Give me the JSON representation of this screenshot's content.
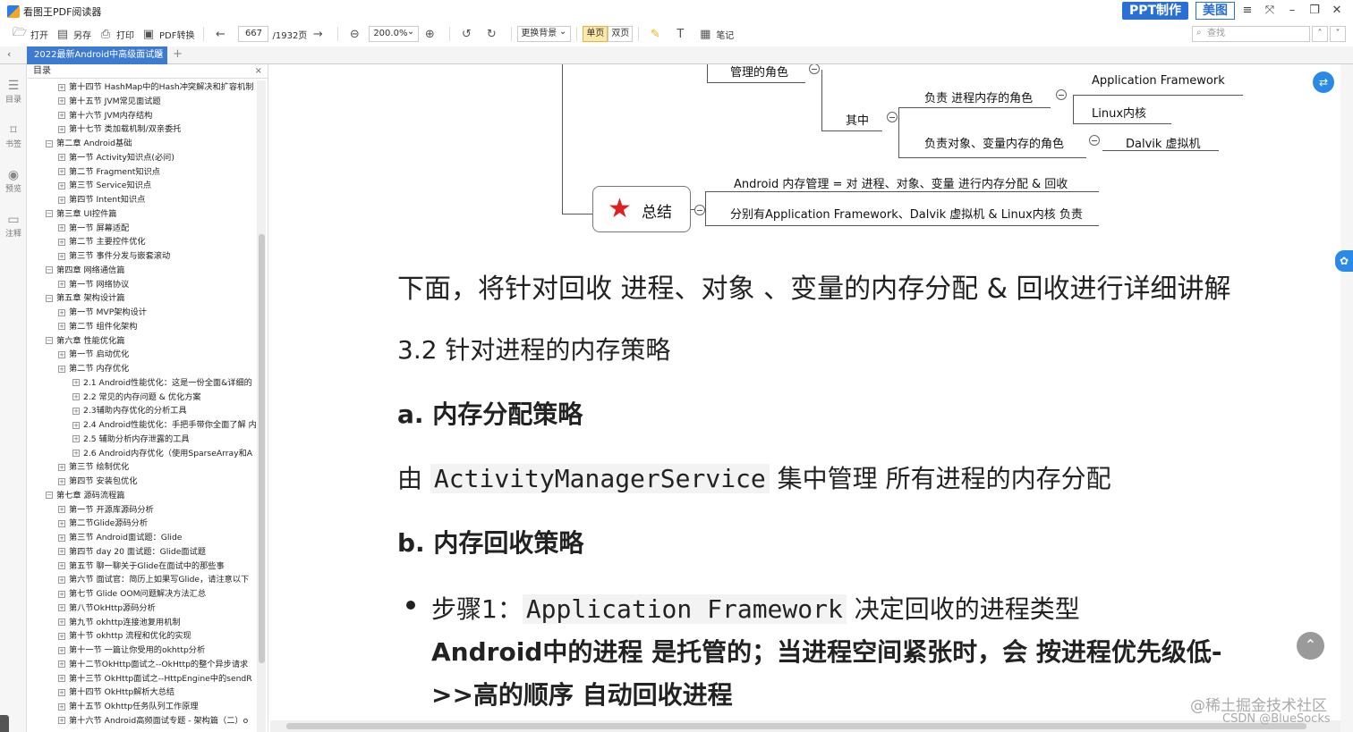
{
  "app": {
    "title": "看图王PDF阅读器",
    "ppt_label": "PPT制作",
    "meitu_label": "美图"
  },
  "toolbar": {
    "open": "打开",
    "saveas": "另存",
    "print": "打印",
    "convert": "PDF转换",
    "page_current": "667",
    "page_total": "/1932页",
    "zoom": "200.0%",
    "background": "更换背景",
    "single": "单页",
    "double": "双页",
    "notes": "笔记",
    "search_placeholder": "查找"
  },
  "tabs": {
    "active": "2022最新Android中高级面试题"
  },
  "rail": {
    "toc": "目录",
    "bookmark": "书签",
    "preview": "预览",
    "annot": "注释"
  },
  "toc": {
    "title": "目录",
    "items": [
      {
        "t": "第十四节 HashMap中的Hash冲突解决和扩容机制",
        "lvl": 1
      },
      {
        "t": "第十五节 JVM常见面试题",
        "lvl": 1
      },
      {
        "t": "第十六节 JVM内存结构",
        "lvl": 1
      },
      {
        "t": "第十七节 类加载机制/双亲委托",
        "lvl": 1
      },
      {
        "t": "第二章 Android基础",
        "lvl": 0
      },
      {
        "t": "第一节 Activity知识点(必问)",
        "lvl": 1
      },
      {
        "t": "第二节 Fragment知识点",
        "lvl": 1
      },
      {
        "t": "第三节 Service知识点",
        "lvl": 1
      },
      {
        "t": "第四节 Intent知识点",
        "lvl": 1
      },
      {
        "t": "第三章 UI控件篇",
        "lvl": 0
      },
      {
        "t": "第一节 屏幕适配",
        "lvl": 1
      },
      {
        "t": "第二节 主要控件优化",
        "lvl": 1
      },
      {
        "t": "第三节 事件分发与嵌套滚动",
        "lvl": 1
      },
      {
        "t": "第四章 网络通信篇",
        "lvl": 0
      },
      {
        "t": "第一节 网络协议",
        "lvl": 1
      },
      {
        "t": "第五章 架构设计篇",
        "lvl": 0
      },
      {
        "t": "第一节 MVP架构设计",
        "lvl": 1
      },
      {
        "t": "第二节 组件化架构",
        "lvl": 1
      },
      {
        "t": "第六章 性能优化篇",
        "lvl": 0
      },
      {
        "t": "第一节 启动优化",
        "lvl": 1
      },
      {
        "t": "第二节 内存优化",
        "lvl": 1
      },
      {
        "t": "2.1 Android性能优化：这是一份全面&详细的",
        "lvl": 2
      },
      {
        "t": "2.2 常见的内存问题 & 优化方案",
        "lvl": 2
      },
      {
        "t": "2.3辅助内存优化的分析工具",
        "lvl": 2
      },
      {
        "t": "2.4 Android性能优化：手把手带你全面了解 内",
        "lvl": 2
      },
      {
        "t": "2.5 辅助分析内存泄露的工具",
        "lvl": 2
      },
      {
        "t": "2.6 Android内存优化（使用SparseArray和A",
        "lvl": 2
      },
      {
        "t": "第三节 绘制优化",
        "lvl": 1
      },
      {
        "t": "第四节 安装包优化",
        "lvl": 1
      },
      {
        "t": "第七章 源码流程篇",
        "lvl": 0
      },
      {
        "t": "第一节 开源库源码分析",
        "lvl": 1
      },
      {
        "t": "第二节Glide源码分析",
        "lvl": 1
      },
      {
        "t": "第三节 Android面试题：Glide",
        "lvl": 1
      },
      {
        "t": "第四节 day 20 面试题：Glide面试题",
        "lvl": 1
      },
      {
        "t": "第五节 聊一聊关于Glide在面试中的那些事",
        "lvl": 1
      },
      {
        "t": "第六节 面试官：简历上如果写Glide，请注意以下",
        "lvl": 1
      },
      {
        "t": "第七节 Glide OOM问题解决方法汇总",
        "lvl": 1
      },
      {
        "t": "第八节OkHttp源码分析",
        "lvl": 1
      },
      {
        "t": "第九节 okhttp连接池复用机制",
        "lvl": 1
      },
      {
        "t": "第十节 okhttp 流程和优化的实现",
        "lvl": 1
      },
      {
        "t": "第十一节 一篇让你受用的okhttp分析",
        "lvl": 1
      },
      {
        "t": "第十二节OkHttp面试之--OkHttp的整个异步请求",
        "lvl": 1
      },
      {
        "t": "第十三节 OkHttp面试之--HttpEngine中的sendR",
        "lvl": 1
      },
      {
        "t": "第十四节 OkHttp解析大总结",
        "lvl": 1
      },
      {
        "t": "第十五节 Okhttp任务队列工作原理",
        "lvl": 1
      },
      {
        "t": "第十六节 Android高频面试专题 - 架构篇（二）o",
        "lvl": 1
      }
    ]
  },
  "mindmap": {
    "role_label": "管理的角色",
    "among": "其中",
    "proc_role": "负责 进程内存的角色",
    "obj_role": "负责对象、变量内存的角色",
    "af": "Application Framework",
    "linux": "Linux内核",
    "dalvik": "Dalvik 虚拟机",
    "summary": "总结",
    "sum1": "Android 内存管理 = 对 进程、对象、变量 进行内存分配 & 回收",
    "sum2": "分别有Application Framework、Dalvik 虚拟机 & Linux内核 负责"
  },
  "content": {
    "p1": "下面，将针对回收 进程、对象 、变量的内存分配 & 回收进行详细讲解",
    "h32": "3.2 针对进程的内存策略",
    "ha": "a. 内存分配策略",
    "pa_pre": "由 ",
    "pa_code": "ActivityManagerService",
    "pa_post": " 集中管理 所有进程的内存分配",
    "hb": "b. 内存回收策略",
    "step_pre": "步骤1：",
    "step_code": "Application Framework",
    "step_post": " 决定回收的进程类型",
    "bold1": "Android中的进程 是托管的；当进程空间紧张时，会 按进程优先级低-",
    "bold2": ">>高的顺序 自动回收进程"
  },
  "watermark": {
    "line1": "@稀土掘金技术社区",
    "line2": "CSDN @BlueSocks"
  }
}
